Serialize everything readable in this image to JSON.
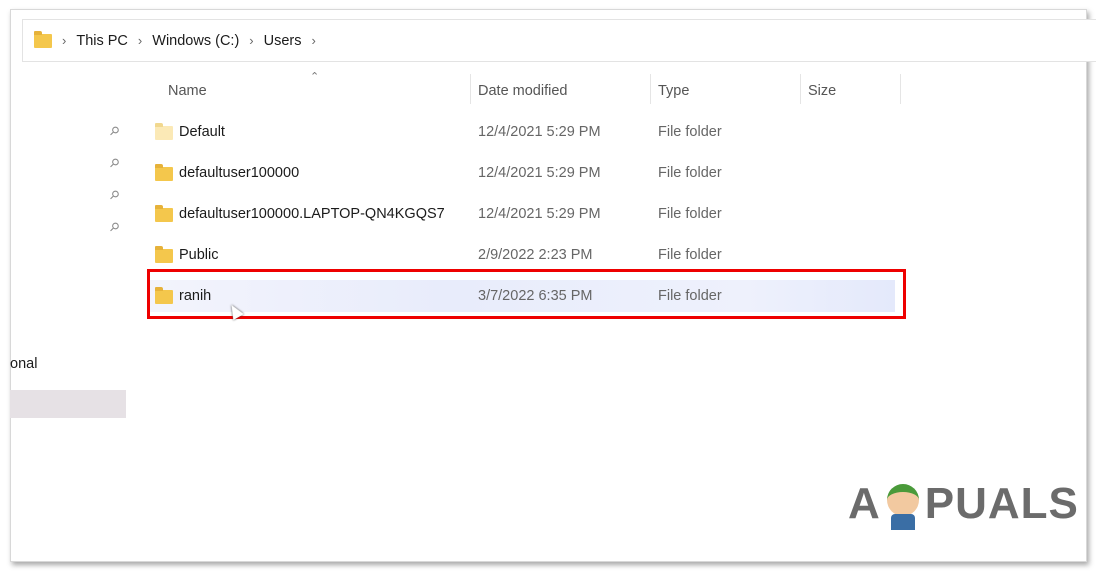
{
  "breadcrumb": [
    "This PC",
    "Windows (C:)",
    "Users"
  ],
  "columns": {
    "name": "Name",
    "date": "Date modified",
    "type": "Type",
    "size": "Size"
  },
  "rows": [
    {
      "name": "Default",
      "date": "12/4/2021 5:29 PM",
      "type": "File folder"
    },
    {
      "name": "defaultuser100000",
      "date": "12/4/2021 5:29 PM",
      "type": "File folder"
    },
    {
      "name": "defaultuser100000.LAPTOP-QN4KGQS7",
      "date": "12/4/2021 5:29 PM",
      "type": "File folder"
    },
    {
      "name": "Public",
      "date": "2/9/2022 2:23 PM",
      "type": "File folder"
    },
    {
      "name": "ranih",
      "date": "3/7/2022 6:35 PM",
      "type": "File folder"
    }
  ],
  "sidebar": {
    "partial_label": "onal"
  },
  "watermark": "APPUALS",
  "highlight_color": "#ee0000"
}
